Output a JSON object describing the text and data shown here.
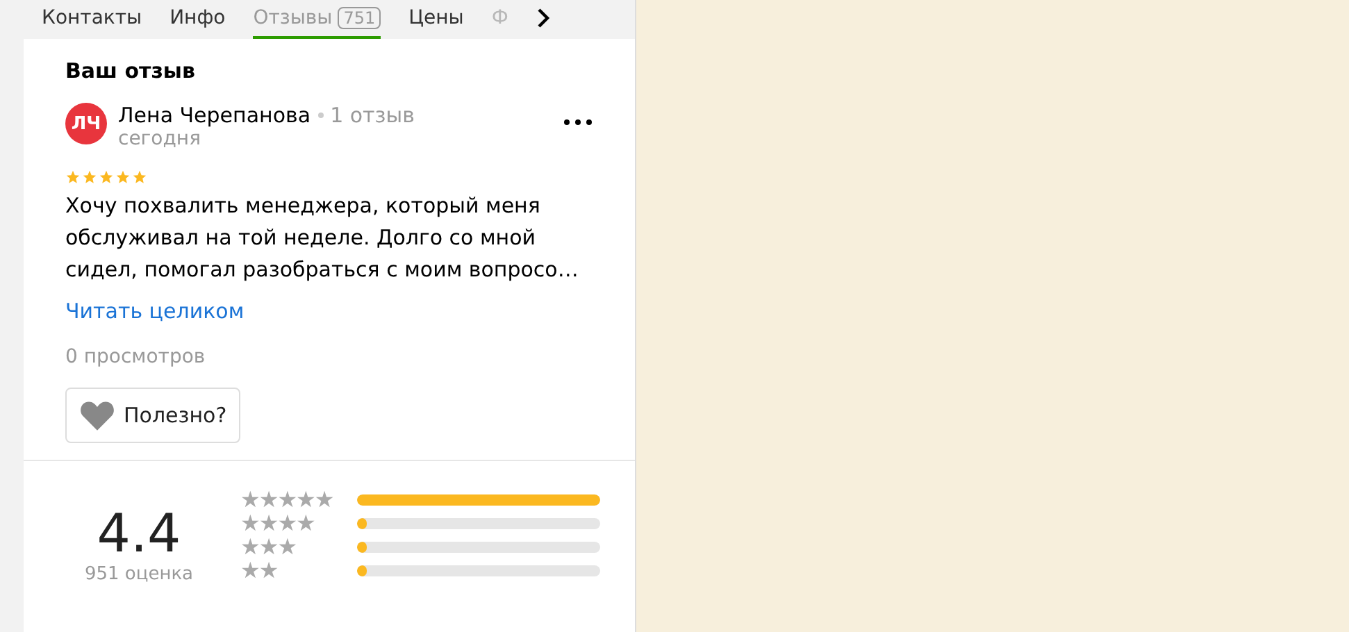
{
  "tabs": [
    {
      "label": "Контакты",
      "selected": false
    },
    {
      "label": "Инфо",
      "selected": false
    },
    {
      "label": "Отзывы",
      "count": "751",
      "selected": true
    },
    {
      "label": "Цены",
      "selected": false
    },
    {
      "label": "Ф",
      "selected": false,
      "faded": true
    }
  ],
  "my_review": {
    "heading": "Ваш отзыв",
    "avatar_initials": "ЛЧ",
    "author": "Лена Черепанова",
    "reviews_count": "1 отзыв",
    "date": "сегодня",
    "stars": 5,
    "text": "Хочу похвалить менеджера, который меня обслуживал на той неделе. Долго со мной сидел, помогал разобраться с моим вопросо…",
    "read_more": "Читать целиком",
    "views": "0 просмотров",
    "helpful": "Полезно?"
  },
  "summary": {
    "rating": "4.4",
    "ratings_count": "951 оценка",
    "bars": [
      {
        "label": "★★★★★",
        "level": 1
      },
      {
        "label": "★★★★",
        "level": 0.02
      },
      {
        "label": "★★★",
        "level": 0.02
      },
      {
        "label": "★★",
        "level": 0.01
      }
    ]
  }
}
